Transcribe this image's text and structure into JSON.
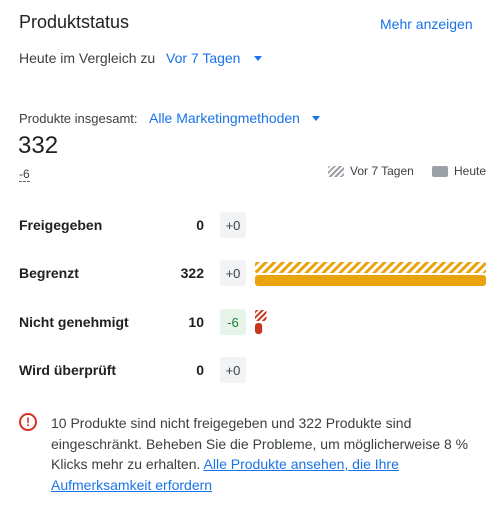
{
  "header": {
    "title": "Produktstatus",
    "more_label": "Mehr anzeigen"
  },
  "comparison": {
    "label": "Heute im Vergleich zu",
    "selected": "Vor 7 Tagen"
  },
  "totals": {
    "label": "Produkte insgesamt:",
    "method_selected": "Alle Marketingmethoden",
    "count": "332",
    "delta": "-6"
  },
  "legend": {
    "previous": "Vor 7 Tagen",
    "current": "Heute"
  },
  "colors": {
    "accent": "#1a73e8",
    "limited": "#e8a30d",
    "disapproved": "#c5361a",
    "warning": "#d93025"
  },
  "rows": [
    {
      "label": "Freigegeben",
      "count": "0",
      "change": "+0"
    },
    {
      "label": "Begrenzt",
      "count": "322",
      "change": "+0"
    },
    {
      "label": "Nicht genehmigt",
      "count": "10",
      "change": "-6"
    },
    {
      "label": "Wird überprüft",
      "count": "0",
      "change": "+0"
    }
  ],
  "chart_data": {
    "type": "bar",
    "categories": [
      "Freigegeben",
      "Begrenzt",
      "Nicht genehmigt",
      "Wird überprüft"
    ],
    "series": [
      {
        "name": "Vor 7 Tagen",
        "values": [
          0,
          322,
          16,
          0
        ]
      },
      {
        "name": "Heute",
        "values": [
          0,
          322,
          10,
          0
        ]
      }
    ]
  },
  "notice": {
    "text": "10 Produkte sind nicht freigegeben und 322 Produkte sind eingeschränkt. Beheben Sie die Probleme, um möglicherweise 8 % Klicks mehr zu erhalten.",
    "link": "Alle Produkte ansehen, die Ihre Aufmerksamkeit erfordern",
    "icon": "alert-icon"
  }
}
